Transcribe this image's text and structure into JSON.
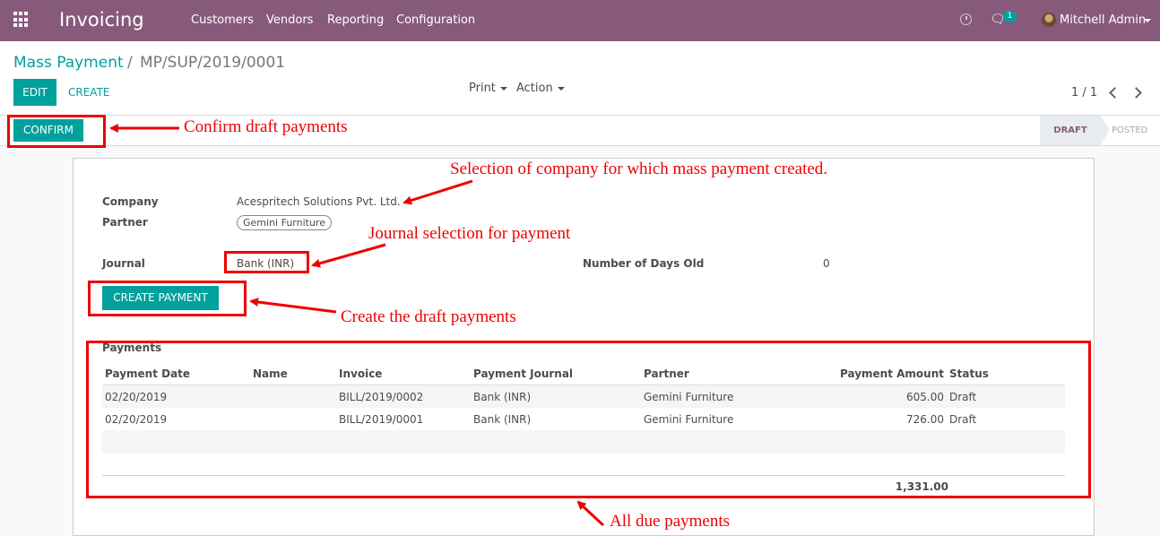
{
  "topbar": {
    "app_title": "Invoicing",
    "menu": [
      "Customers",
      "Vendors",
      "Reporting",
      "Configuration"
    ],
    "chat_count": "1",
    "user_name": "Mitchell Admin",
    "color": "#875a7b"
  },
  "breadcrumb": {
    "parent": "Mass Payment",
    "separator": "/",
    "current": "MP/SUP/2019/0001"
  },
  "toolbar": {
    "edit_label": "EDIT",
    "create_label": "CREATE",
    "print_label": "Print",
    "action_label": "Action",
    "pager": "1 / 1"
  },
  "statusbar": {
    "confirm_label": "CONFIRM",
    "stages": [
      "DRAFT",
      "POSTED"
    ],
    "active_stage": "DRAFT"
  },
  "form": {
    "company_label": "Company",
    "company_value": "Acespritech Solutions Pvt. Ltd.",
    "partner_label": "Partner",
    "partner_value": "Gemini Furniture",
    "journal_label": "Journal",
    "journal_value": "Bank (INR)",
    "days_old_label": "Number of Days Old",
    "days_old_value": "0",
    "create_payment_label": "CREATE PAYMENT"
  },
  "payments": {
    "title": "Payments",
    "columns": [
      "Payment Date",
      "Name",
      "Invoice",
      "Payment Journal",
      "Partner",
      "Payment Amount",
      "Status"
    ],
    "rows": [
      {
        "date": "02/20/2019",
        "name": "",
        "invoice": "BILL/2019/0002",
        "journal": "Bank (INR)",
        "partner": "Gemini Furniture",
        "amount": "605.00",
        "status": "Draft"
      },
      {
        "date": "02/20/2019",
        "name": "",
        "invoice": "BILL/2019/0001",
        "journal": "Bank (INR)",
        "partner": "Gemini Furniture",
        "amount": "726.00",
        "status": "Draft"
      }
    ],
    "total": "1,331.00"
  },
  "annotations": {
    "confirm": "Confirm draft payments",
    "company": "Selection of company for which mass payment created.",
    "journal": "Journal selection for payment",
    "create": "Create the draft payments",
    "due": "All due payments",
    "color": "#e00000"
  }
}
